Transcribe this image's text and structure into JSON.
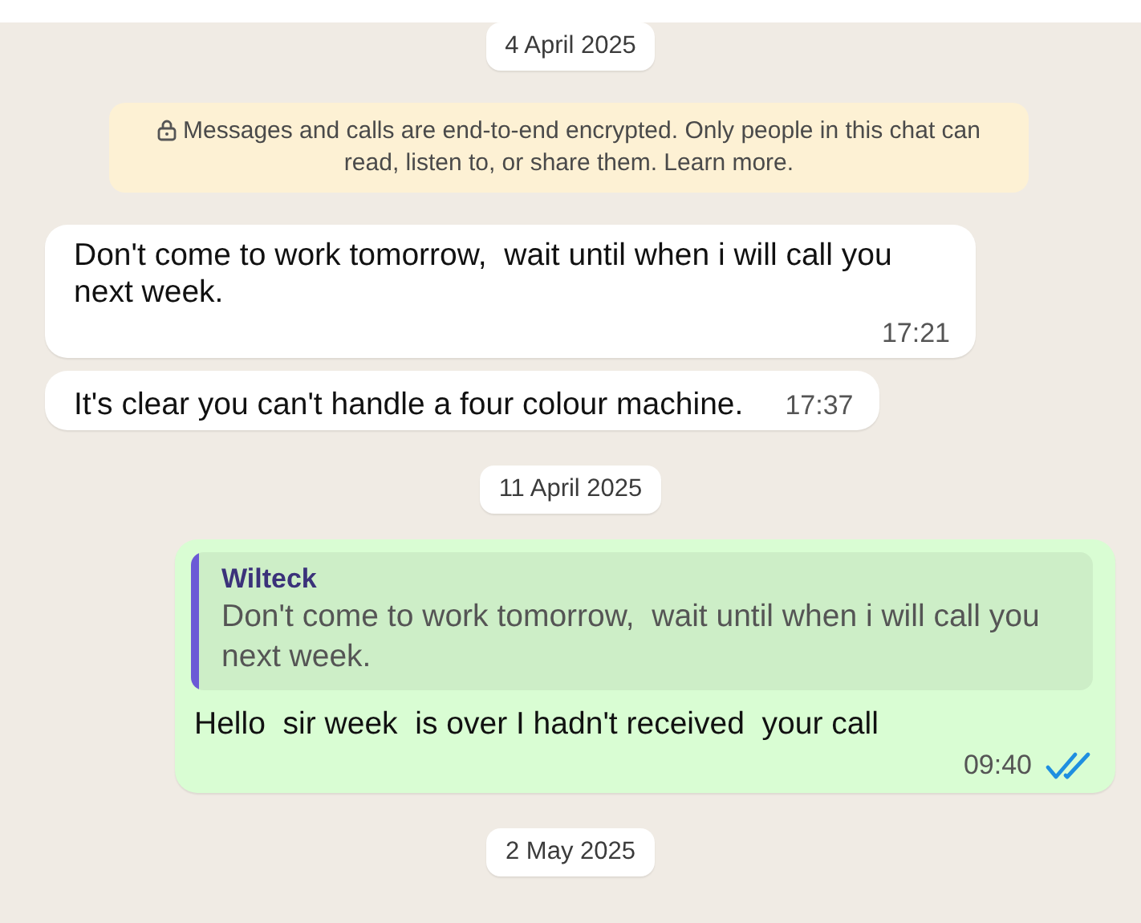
{
  "chat": [
    {
      "kind": "date",
      "text": "4 April 2025"
    },
    {
      "kind": "notice",
      "text": "Messages and calls are end-to-end encrypted. Only people in this chat can read, listen to, or share them. Learn more."
    },
    {
      "kind": "incoming",
      "text": "Don't come to work tomorrow,  wait until when i will call you next week.",
      "time": "17:21"
    },
    {
      "kind": "incoming",
      "text": "It's clear you can't handle a four colour machine.",
      "time": "17:37"
    },
    {
      "kind": "date",
      "text": "11 April 2025"
    },
    {
      "kind": "outgoing",
      "quote": {
        "author": "Wilteck",
        "text": "Don't come to work tomorrow,  wait until when i will call you next week."
      },
      "text": "Hello  sir week  is over I hadn't received  your call",
      "time": "09:40",
      "read": true
    },
    {
      "kind": "date",
      "text": "2 May 2025"
    }
  ]
}
